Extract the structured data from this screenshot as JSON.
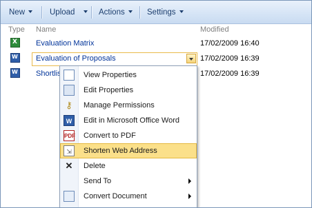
{
  "toolbar": {
    "new_label": "New",
    "upload_label": "Upload",
    "actions_label": "Actions",
    "settings_label": "Settings"
  },
  "columns": {
    "type": "Type",
    "name": "Name",
    "modified": "Modified"
  },
  "rows": [
    {
      "name": "Evaluation Matrix",
      "modified": "17/02/2009 16:40",
      "icon": "excel-file-icon"
    },
    {
      "name": "Evaluation of Proposals",
      "modified": "17/02/2009 16:39",
      "icon": "word-file-icon"
    },
    {
      "name": "Shortlis",
      "modified": "17/02/2009 16:39",
      "icon": "word-file-icon"
    }
  ],
  "menu": {
    "items": [
      {
        "label": "View Properties",
        "icon": "properties-icon"
      },
      {
        "label": "Edit Properties",
        "icon": "edit-properties-icon"
      },
      {
        "label": "Manage Permissions",
        "icon": "permissions-icon"
      },
      {
        "label": "Edit in Microsoft Office Word",
        "icon": "word-icon"
      },
      {
        "label": "Convert to PDF",
        "icon": "pdf-icon"
      },
      {
        "label": "Shorten Web Address",
        "icon": "shorten-icon"
      },
      {
        "label": "Delete",
        "icon": "delete-icon"
      },
      {
        "label": "Send To",
        "icon": "none"
      },
      {
        "label": "Convert Document",
        "icon": "convert-icon"
      }
    ],
    "highlighted_index": 5,
    "highlight_color": "#fbe08a"
  },
  "colors": {
    "link": "#003399",
    "header_text": "#7f7f7f",
    "toolbar_text": "#1c3e6e",
    "selection_border": "#e9b949"
  }
}
